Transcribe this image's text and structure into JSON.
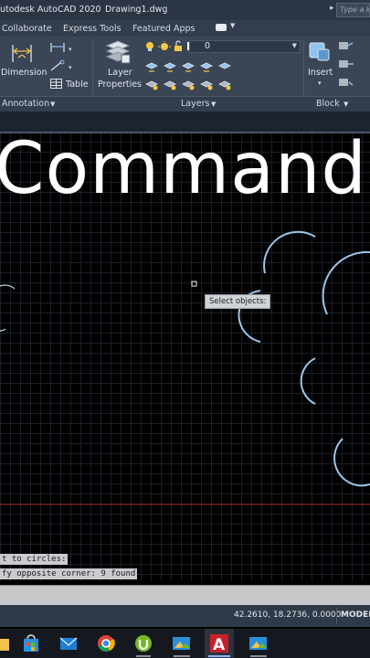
{
  "titlebar": {
    "app_title": "utodesk AutoCAD 2020",
    "doc_title": "Drawing1.dwg",
    "search_placeholder": "Type a k"
  },
  "ribbon": {
    "tabs": [
      {
        "label": "Collaborate"
      },
      {
        "label": "Express Tools"
      },
      {
        "label": "Featured Apps"
      }
    ],
    "annotation": {
      "dimension_label": "Dimension",
      "table_label": "Table",
      "panel_label": "Annotation"
    },
    "layers": {
      "layer_properties_line1": "Layer",
      "layer_properties_line2": "Properties",
      "current_layer": "0",
      "panel_label": "Layers"
    },
    "block": {
      "insert_label": "Insert",
      "panel_label": "Block"
    }
  },
  "drawing": {
    "overlay_text": "Command",
    "tooltip": "Select objects:"
  },
  "command_history": [
    {
      "text": "t to circles:"
    },
    {
      "text": "fy opposite corner: 9 found"
    }
  ],
  "statusbar": {
    "coordinates": "42.2610, 18.2736, 0.0000",
    "model": "MODEL"
  },
  "colors": {
    "ribbon": "#3a4556",
    "canvas": "#000000",
    "circles": "#9cc6ea",
    "axis_line": "#7a1f1f",
    "bulb": "#f5c842"
  },
  "taskbar": {
    "apps": [
      {
        "name": "file-explorer-icon"
      },
      {
        "name": "store-icon"
      },
      {
        "name": "mail-icon"
      },
      {
        "name": "chrome-icon"
      },
      {
        "name": "utorrent-icon"
      },
      {
        "name": "photos-icon"
      },
      {
        "name": "autocad-icon"
      },
      {
        "name": "photos2-icon"
      }
    ]
  }
}
